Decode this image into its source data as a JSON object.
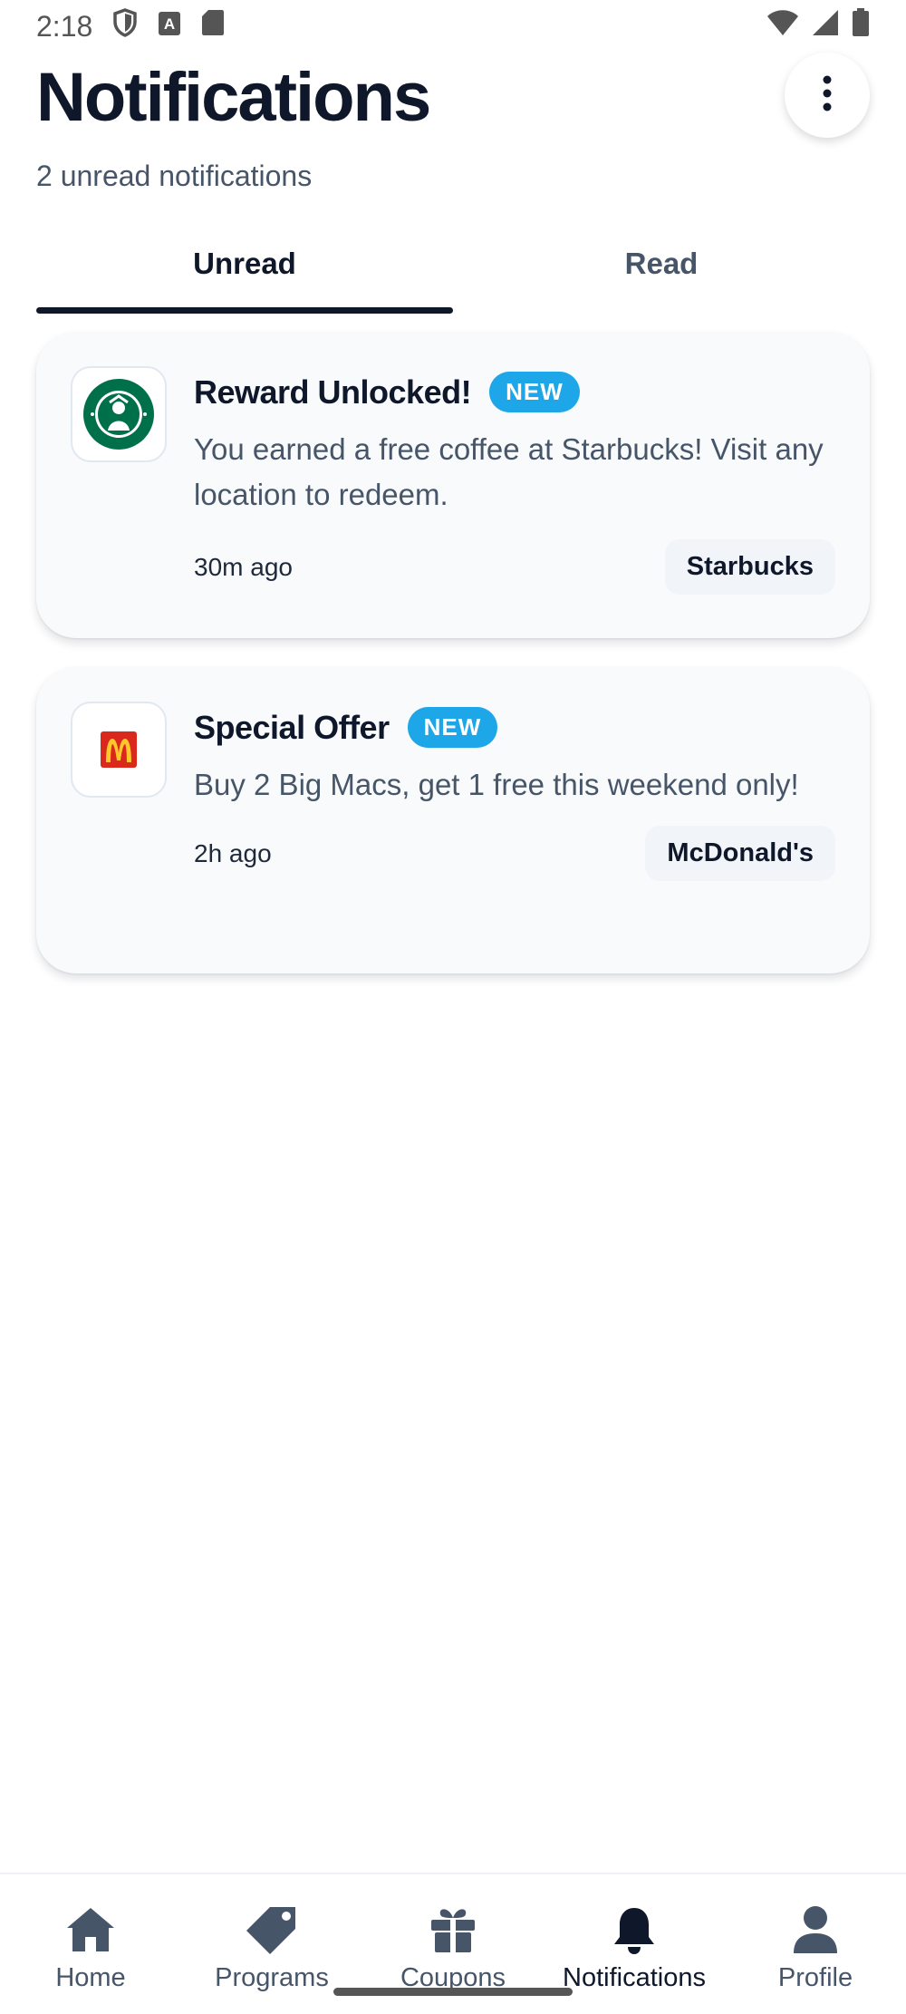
{
  "status_bar": {
    "time": "2:18",
    "icons": [
      "shield-icon",
      "a-icon",
      "sd-card-icon",
      "wifi-icon",
      "signal-icon",
      "battery-icon"
    ]
  },
  "header": {
    "title": "Notifications",
    "subtitle": "2 unread notifications",
    "menu_icon": "more-vertical-icon"
  },
  "tabs": [
    {
      "label": "Unread",
      "active": true
    },
    {
      "label": "Read",
      "active": false
    }
  ],
  "notifications": [
    {
      "title": "Reward Unlocked!",
      "badge": "NEW",
      "message": "You earned a free coffee at Starbucks! Visit any location to redeem.",
      "time": "30m ago",
      "store": "Starbucks",
      "logo": "starbucks-logo",
      "logo_color": "#00704A"
    },
    {
      "title": "Special Offer",
      "badge": "NEW",
      "message": "Buy 2 Big Macs, get 1 free this weekend only!",
      "time": "2h ago",
      "store": "McDonald's",
      "logo": "mcdonalds-logo",
      "logo_color": "#DA291C"
    }
  ],
  "bottom_nav": [
    {
      "label": "Home",
      "icon": "home-icon",
      "active": false
    },
    {
      "label": "Programs",
      "icon": "tag-icon",
      "active": false
    },
    {
      "label": "Coupons",
      "icon": "gift-icon",
      "active": false
    },
    {
      "label": "Notifications",
      "icon": "bell-icon",
      "active": true
    },
    {
      "label": "Profile",
      "icon": "person-icon",
      "active": false
    }
  ],
  "colors": {
    "accent": "#1ea7e8",
    "text_primary": "#0f172a",
    "text_secondary": "#475569",
    "card_bg": "#f8fafc"
  }
}
